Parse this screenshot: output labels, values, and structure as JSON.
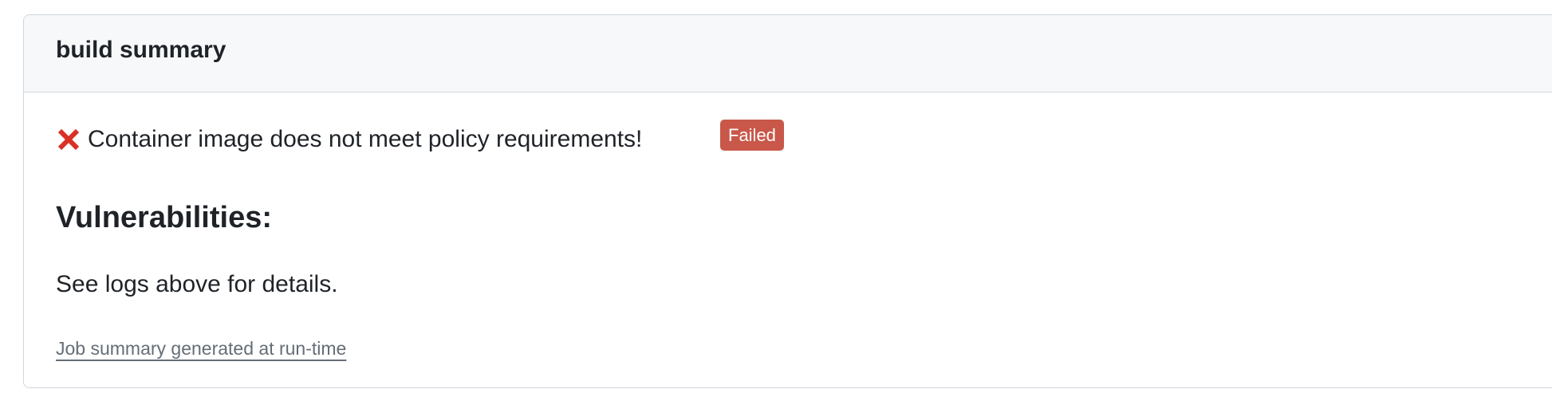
{
  "summary": {
    "title": "build summary",
    "status_icon": "red-x-icon",
    "status_message": "Container image does not meet policy requirements!",
    "badge_label": "Failed",
    "colors": {
      "badge_background": "#c9584a",
      "error_icon": "#d93025",
      "header_background": "#f6f8fa",
      "border": "#d0d7de"
    },
    "vulnerabilities_heading": "Vulnerabilities:",
    "details_text": "See logs above for details.",
    "footer_link": "Job summary generated at run-time"
  }
}
